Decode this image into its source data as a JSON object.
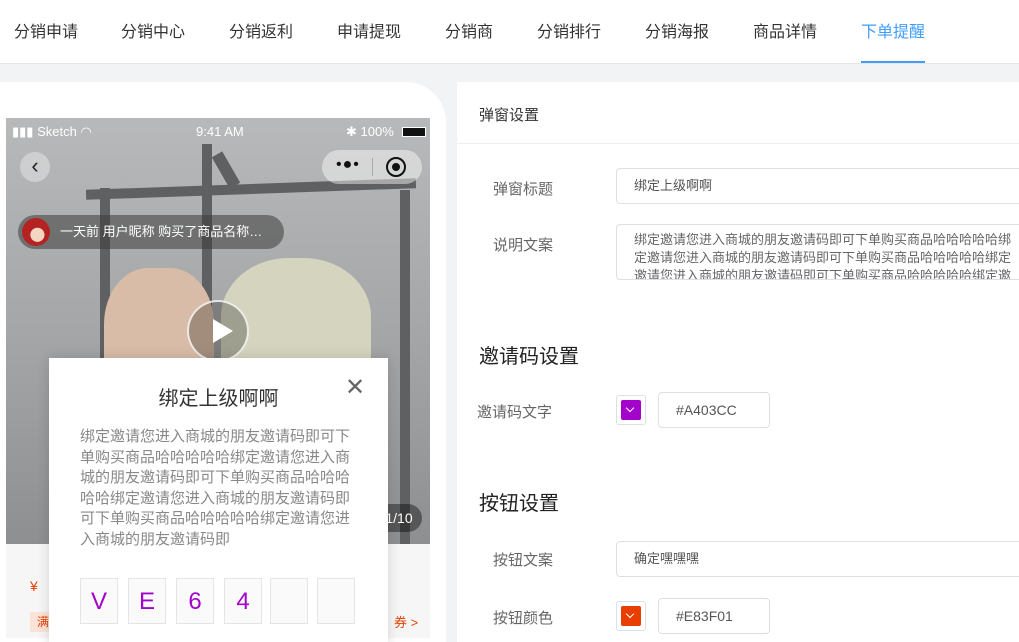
{
  "tabs": [
    {
      "label": "分销申请"
    },
    {
      "label": "分销中心"
    },
    {
      "label": "分销返利"
    },
    {
      "label": "申请提现"
    },
    {
      "label": "分销商"
    },
    {
      "label": "分销排行"
    },
    {
      "label": "分销海报"
    },
    {
      "label": "商品详情"
    },
    {
      "label": "下单提醒",
      "active": true
    }
  ],
  "phone": {
    "status_left": "Sketch",
    "status_time": "9:41 AM",
    "status_battery": "100%",
    "back_icon": "chevron-left-icon",
    "capsule_more_icon": "more-dots-icon",
    "capsule_target_icon": "target-icon",
    "order_notice": "一天前 用户昵称 购买了商品名称…",
    "page_counter": "1/10",
    "price_symbol": "¥",
    "tag_label": "满",
    "tag_arrow": "券 >"
  },
  "modal": {
    "title": "绑定上级啊啊",
    "close_icon": "close-icon",
    "description": "绑定邀请您进入商城的朋友邀请码即可下单购买商品哈哈哈哈哈绑定邀请您进入商城的朋友邀请码即可下单购买商品哈哈哈哈哈绑定邀请您进入商城的朋友邀请码即可下单购买商品哈哈哈哈哈绑定邀请您进入商城的朋友邀请码即",
    "code": [
      "V",
      "E",
      "6",
      "4",
      "",
      ""
    ],
    "code_color": "#A403CC"
  },
  "settings": {
    "header": "弹窗设置",
    "popup_title_label": "弹窗标题",
    "popup_title_value": "绑定上级啊啊",
    "description_label": "说明文案",
    "description_value": "绑定邀请您进入商城的朋友邀请码即可下单购买商品哈哈哈哈哈绑定邀请您进入商城的朋友邀请码即可下单购买商品哈哈哈哈哈绑定邀请您进入商城的朋友邀请码即可下单购买商品哈哈哈哈哈绑定邀请您进入商城的朋友邀请码即可下单购买商品哈哈哈哈哈",
    "invite_section": "邀请码设置",
    "invite_text_label": "邀请码文字",
    "invite_text_color": "#A403CC",
    "button_section": "按钮设置",
    "button_text_label": "按钮文案",
    "button_text_value": "确定嘿嘿嘿",
    "button_color_label": "按钮颜色",
    "button_color": "#E83F01"
  }
}
